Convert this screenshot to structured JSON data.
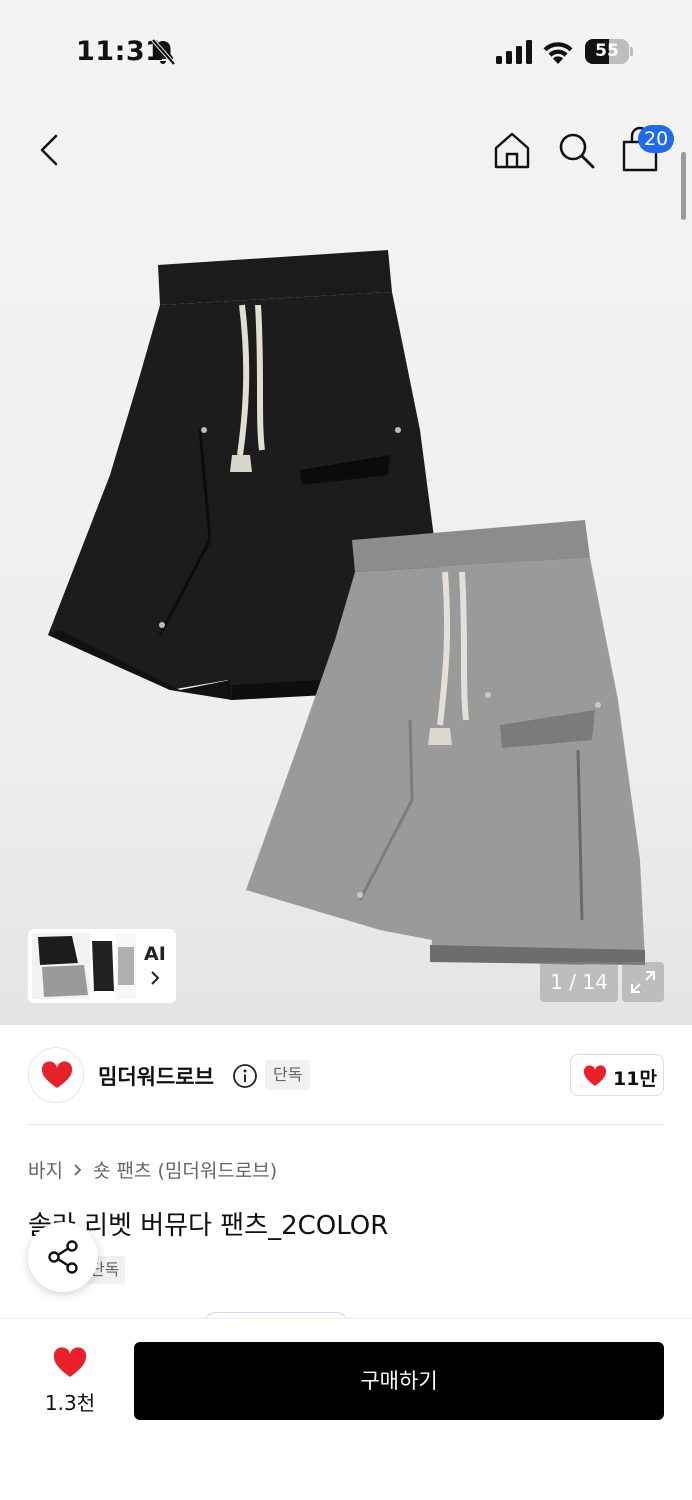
{
  "status_bar": {
    "time": "11:31",
    "battery": "55",
    "battery_level": 0.55
  },
  "nav": {
    "cart_count": "20"
  },
  "gallery": {
    "ai_label": "AI",
    "counter": "1 / 14"
  },
  "brand": {
    "name": "밈더워드로브",
    "tag": "단독",
    "likes": "11만"
  },
  "product": {
    "breadcrumb": [
      "바지",
      "숏 팬츠 (밈더워드로브)"
    ],
    "title": "솔라 리벳 버뮤다 팬츠_2COLOR",
    "tag": "단독"
  },
  "bottom_bar": {
    "wish_count": "1.3천",
    "buy_label": "구매하기"
  },
  "colors": {
    "accent_blue": "#1f6bf0",
    "heart_red": "#e8202a",
    "buy_button": "#000000"
  },
  "icons": [
    "bell-off-icon",
    "signal-icon",
    "wifi-icon",
    "battery-icon",
    "back-icon",
    "home-icon",
    "search-icon",
    "cart-icon",
    "chevron-right-icon",
    "expand-icon",
    "info-icon",
    "heart-icon",
    "share-icon"
  ]
}
